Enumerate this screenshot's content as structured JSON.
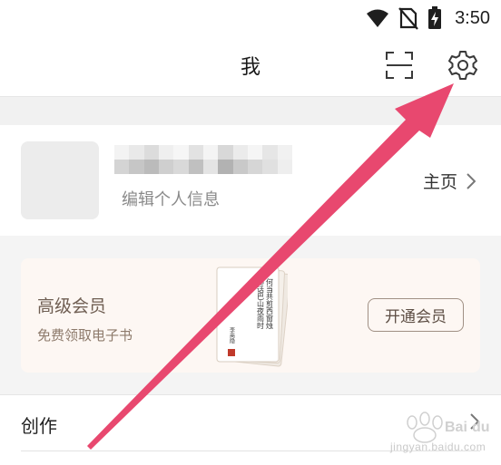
{
  "status_bar": {
    "time": "3:50",
    "icons": [
      "wifi-icon",
      "no-sim-icon",
      "battery-charging-icon"
    ]
  },
  "header": {
    "title": "我",
    "scan_icon": "scan-icon",
    "settings_icon": "gear-icon"
  },
  "profile": {
    "username_obscured": true,
    "edit_label": "编辑个人信息",
    "homepage_label": "主页"
  },
  "vip": {
    "title": "高级会员",
    "subtitle": "免费领取电子书",
    "button_label": "开通会员",
    "book_text": "何当共剪西窗烛 却话巴山夜雨时",
    "book_author": "李商隐"
  },
  "menu": {
    "create_label": "创作"
  },
  "watermark": {
    "text": "jingyan.baidu.com"
  },
  "colors": {
    "arrow": "#e8486f",
    "vip_bg": "#fdf7f3",
    "seal": "#c0392b"
  }
}
